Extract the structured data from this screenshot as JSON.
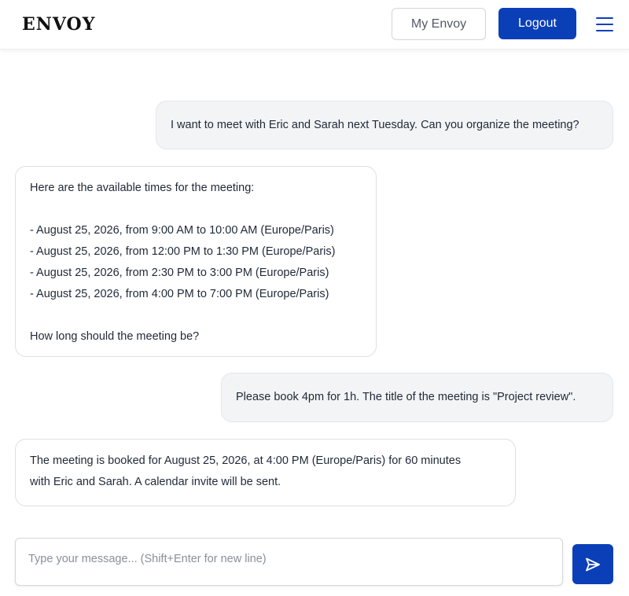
{
  "header": {
    "brand": "ENVOY",
    "my_envoy_label": "My Envoy",
    "logout_label": "Logout",
    "menu_icon": "hamburger-menu-icon"
  },
  "colors": {
    "primary": "#0b3fb8",
    "user_bubble_bg": "#f3f4f6",
    "bot_bubble_border": "#dedfe3"
  },
  "messages": [
    {
      "role": "user",
      "lines": [
        "I want to meet with Eric and Sarah next Tuesday. Can you organize the meeting?"
      ]
    },
    {
      "role": "assistant",
      "lines": [
        "Here are the available times for the meeting:",
        "",
        "- August 25, 2026, from 9:00 AM to 10:00 AM (Europe/Paris)",
        "- August 25, 2026, from 12:00 PM to 1:30 PM (Europe/Paris)",
        "- August 25, 2026, from 2:30 PM to 3:00 PM (Europe/Paris)",
        "- August 25, 2026, from 4:00 PM to 7:00 PM (Europe/Paris)",
        "",
        "How long should the meeting be?"
      ]
    },
    {
      "role": "user",
      "lines": [
        "Please book 4pm for 1h. The title of the meeting is \"Project review\"."
      ]
    },
    {
      "role": "assistant",
      "lines": [
        "The meeting is booked for August 25, 2026, at 4:00 PM (Europe/Paris) for 60 minutes",
        "with Eric and Sarah. A calendar invite will be sent."
      ]
    }
  ],
  "composer": {
    "placeholder": "Type your message... (Shift+Enter for new line)",
    "value": "",
    "send_icon": "send-icon"
  }
}
